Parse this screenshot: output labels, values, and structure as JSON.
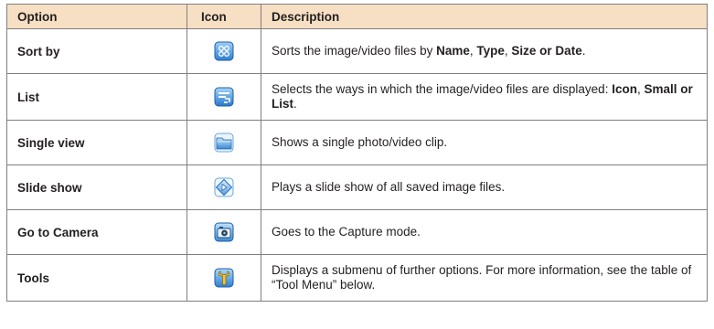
{
  "header": {
    "option": "Option",
    "icon": "Icon",
    "description": "Description"
  },
  "rows": [
    {
      "option": "Sort by",
      "icon": "sort-by-icon",
      "desc": {
        "p1": "Sorts the image/video files by ",
        "b1": "Name",
        "p2": ", ",
        "b2": "Type",
        "p3": ", ",
        "b3": "Size or Date",
        "p4": "."
      }
    },
    {
      "option": "List",
      "icon": "list-icon",
      "desc": {
        "p1": "Selects the ways in which the image/video files are displayed: ",
        "b1": "Icon",
        "p2": ", ",
        "b2": "Small or List",
        "p3": "."
      }
    },
    {
      "option": "Single view",
      "icon": "single-view-icon",
      "desc": {
        "p1": "Shows a single photo/video clip."
      }
    },
    {
      "option": "Slide show",
      "icon": "slide-show-icon",
      "desc": {
        "p1": "Plays a slide show of all saved image files."
      }
    },
    {
      "option": "Go to Camera",
      "icon": "camera-icon",
      "desc": {
        "p1": "Goes to the Capture mode."
      }
    },
    {
      "option": "Tools",
      "icon": "tools-icon",
      "desc": {
        "p1": "Displays a submenu of further options. For more information, see the table of “Tool Menu” below."
      }
    }
  ],
  "colors": {
    "header_bg": "#f7dfc4",
    "border": "#7f7f7f",
    "icon_blue": "#3a8fd8"
  }
}
